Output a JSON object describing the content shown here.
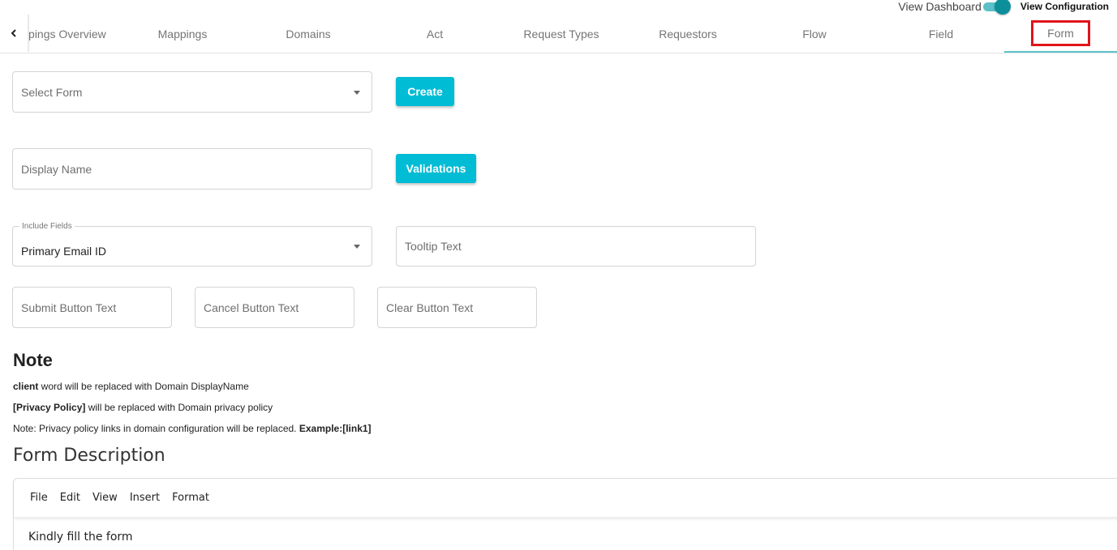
{
  "toggle": {
    "left_label": "View Dashboard",
    "right_label": "View Configuration",
    "state": "on",
    "color": "#0c8f9b"
  },
  "tabs": {
    "prev_icon": "chevron-left-icon",
    "items": [
      {
        "label": "ppings Overview"
      },
      {
        "label": "Mappings"
      },
      {
        "label": "Domains"
      },
      {
        "label": "Act"
      },
      {
        "label": "Request Types"
      },
      {
        "label": "Requestors"
      },
      {
        "label": "Flow"
      },
      {
        "label": "Field"
      },
      {
        "label": "Form",
        "active": true
      }
    ],
    "accent": "#5bc3cc",
    "highlight": "#e0141a"
  },
  "form": {
    "select_form_placeholder": "Select Form",
    "create_label": "Create",
    "display_name_placeholder": "Display Name",
    "validations_label": "Validations",
    "include_fields_label": "Include Fields",
    "include_fields_value": "Primary Email ID",
    "tooltip_placeholder": "Tooltip Text",
    "submit_placeholder": "Submit Button Text",
    "cancel_placeholder": "Cancel Button Text",
    "clear_placeholder": "Clear Button Text",
    "button_color": "#00bcd4"
  },
  "note": {
    "title": "Note",
    "line1_bold": "client",
    "line1_rest": " word will be replaced with Domain DisplayName",
    "line2_bold": "[Privacy Policy]",
    "line2_rest": " will be replaced with Domain privacy policy",
    "line3_text": "Note: Privacy policy links in domain configuration will be replaced. ",
    "line3_bold": "Example:[link1]"
  },
  "description": {
    "title": "Form Description",
    "menu": [
      "File",
      "Edit",
      "View",
      "Insert",
      "Format"
    ],
    "body": "Kindly fill the form"
  }
}
